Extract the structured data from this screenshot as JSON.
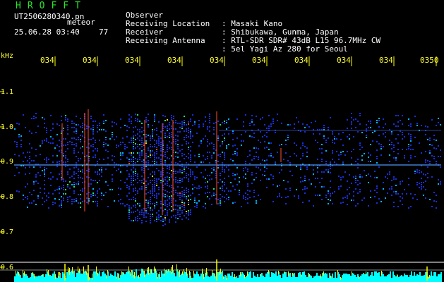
{
  "header": {
    "title": "HROFFT",
    "filename": "UT2506280340.pn",
    "mode_label": "meteor",
    "datetime": "25.06.28 03:40",
    "count": "77"
  },
  "info": [
    {
      "label": "Observer",
      "value": ": Masaki Kano"
    },
    {
      "label": "Receiving Location",
      "value": ": Shibukawa, Gunma, Japan"
    },
    {
      "label": "Receiver",
      "value": ": RTL-SDR SDR# 43dB L15 96.7MHz CW"
    },
    {
      "label": "Receiving Antenna",
      "value": ": 5el Yagi Az 280 for Seoul"
    }
  ],
  "freq_axis": {
    "unit": "kHz",
    "ticks": [
      "1.1",
      "1.0",
      "0.9",
      "0.8",
      "0.7",
      "0.6"
    ]
  },
  "time_axis": {
    "ticks": [
      "034",
      "034",
      "034",
      "034",
      "034",
      "034",
      "034",
      "034",
      "034",
      "0350"
    ]
  },
  "colors": {
    "background": "#000000",
    "title": "#27e627",
    "axis_text": "#ffff33",
    "info_text": "#ffffff",
    "tick_marks": "#ffff00",
    "baseline": "#ffffff",
    "level_fill": "#00ffff",
    "level_peak": "#ffff00"
  }
}
